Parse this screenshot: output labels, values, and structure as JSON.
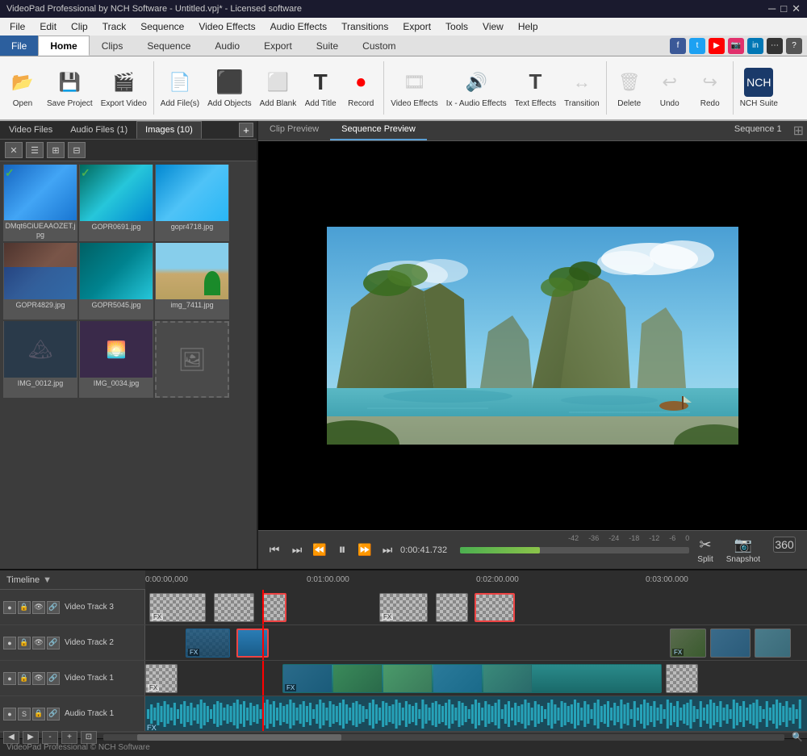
{
  "titlebar": {
    "title": "VideoPad Professional by NCH Software - Untitled.vpj* - Licensed software",
    "controls": [
      "–",
      "□",
      "✕"
    ]
  },
  "menubar": {
    "items": [
      "File",
      "Edit",
      "Clip",
      "Track",
      "Sequence",
      "Video Effects",
      "Audio Effects",
      "Transitions",
      "Export",
      "Tools",
      "View",
      "Help"
    ]
  },
  "ribbon_tabs": {
    "tabs": [
      "File",
      "Home",
      "Clips",
      "Sequence",
      "Audio",
      "Export",
      "Suite",
      "Custom"
    ],
    "active": "Home"
  },
  "ribbon_buttons": [
    {
      "id": "open",
      "icon": "📂",
      "label": "Open"
    },
    {
      "id": "save-project",
      "icon": "💾",
      "label": "Save Project"
    },
    {
      "id": "export-video",
      "icon": "🎬",
      "label": "Export Video"
    },
    {
      "id": "add-files",
      "icon": "📄",
      "label": "Add File(s)"
    },
    {
      "id": "add-objects",
      "icon": "⬛",
      "label": "Add Objects"
    },
    {
      "id": "add-blank",
      "icon": "⬜",
      "label": "Add Blank"
    },
    {
      "id": "add-title",
      "icon": "T",
      "label": "Add Title"
    },
    {
      "id": "record",
      "icon": "⏺",
      "label": "Record"
    },
    {
      "id": "video-effects",
      "icon": "🎞",
      "label": "Video Effects"
    },
    {
      "id": "audio-effects",
      "icon": "🔊",
      "label": "Audio Effects"
    },
    {
      "id": "text-effects",
      "icon": "T",
      "label": "Text Effects"
    },
    {
      "id": "transition",
      "icon": "▶",
      "label": "Transition"
    },
    {
      "id": "delete",
      "icon": "🗑",
      "label": "Delete"
    },
    {
      "id": "undo",
      "icon": "↩",
      "label": "Undo"
    },
    {
      "id": "redo",
      "icon": "↪",
      "label": "Redo"
    },
    {
      "id": "nch-suite",
      "icon": "⬛",
      "label": "NCH Suite"
    }
  ],
  "media_tabs": [
    "Video Files",
    "Audio Files (1)",
    "Images (10)"
  ],
  "active_media_tab": "Images (10)",
  "media_files": [
    {
      "name": "DMqt6CiUEAAOZET.jpg",
      "checked": true,
      "color": "img-blue"
    },
    {
      "name": "GOPR0691.jpg",
      "checked": true,
      "color": "img-teal"
    },
    {
      "name": "gopr4718.jpg",
      "checked": false,
      "color": "img-sky"
    },
    {
      "name": "GOPR4829.jpg",
      "checked": false,
      "color": "img-dark"
    },
    {
      "name": "GOPR5045.jpg",
      "checked": false,
      "color": "img-teal"
    },
    {
      "name": "img_7411.jpg",
      "checked": false,
      "color": "img-beach"
    }
  ],
  "preview": {
    "tabs": [
      "Clip Preview",
      "Sequence Preview"
    ],
    "active_tab": "Sequence Preview",
    "title": "Sequence 1",
    "timestamp": "0:00:41.732"
  },
  "player": {
    "controls": [
      "⏮",
      "⏭",
      "⏪",
      "⏸",
      "⏩",
      "⏭"
    ],
    "time": "0:00:41.732",
    "volume_labels": [
      "-42",
      "-36",
      "-24",
      "-18",
      "-12",
      "-6",
      "0"
    ],
    "split_label": "Split",
    "snapshot_label": "Snapshot",
    "vr360_label": "360"
  },
  "timeline": {
    "label": "Timeline",
    "time_markers": [
      "0:00:00,000",
      "0:01:00.000",
      "0:02:00.000",
      "0:03:00.000"
    ],
    "tracks": [
      {
        "name": "Video Track 3",
        "type": "video"
      },
      {
        "name": "Video Track 2",
        "type": "video"
      },
      {
        "name": "Video Track 1",
        "type": "video"
      },
      {
        "name": "Audio Track 1",
        "type": "audio"
      }
    ]
  },
  "statusbar": {
    "text": "VideoPad Professional © NCH Software"
  }
}
